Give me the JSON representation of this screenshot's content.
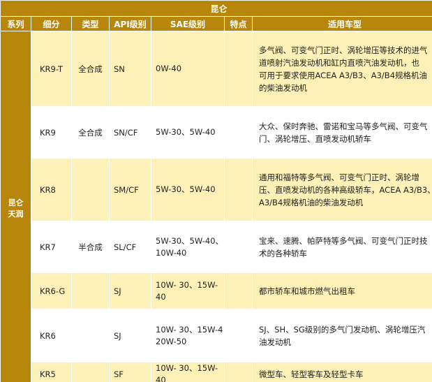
{
  "title": "昆仑",
  "headers": [
    "系列",
    "细分",
    "类型",
    "API级别",
    "SAE级别",
    "特点",
    "适用车型"
  ],
  "series_label": [
    "昆仑",
    "天润"
  ],
  "rows": [
    {
      "code": "KR9-T",
      "type": "全合成",
      "api": "SN",
      "sae": "0W-40",
      "feature": "",
      "cars": [
        "多气阀、可变气门正时、涡轮增压等技术的进气",
        "道喷射汽油发动机和缸内直喷汽油发动机，也",
        "可用于要求使用ACEA A3/B3、A3/B4规格机油",
        "的柴油发动机"
      ]
    },
    {
      "code": "KR9",
      "type": "全合成",
      "api": "SN/CF",
      "sae": "5W-30、5W-40",
      "feature": "",
      "cars": [
        "大众、保时奔驰、雷诺和宝马等多气阀、可变气",
        "门、涡轮增压、直喷发动机轿车"
      ]
    },
    {
      "code": "KR8",
      "type": "",
      "api": "SM/CF",
      "sae": "5W-30、5W-40",
      "feature": "",
      "cars": [
        "通用和福特等多气阀、可变气门正时、涡轮增",
        "压、直喷发动机的各种高级轿车，ACEA A3/B3、",
        "A3/B4规格机油的柴油发动机"
      ]
    },
    {
      "code": "KR7",
      "type": "半合成",
      "api": "SL/CF",
      "sae": [
        "5W-30、5W-40、",
        "10W-40"
      ],
      "feature": "",
      "cars": [
        "宝来、速腾、帕萨特等多气阀、可变气门正时技",
        "术的各种轿车"
      ]
    },
    {
      "code": "KR6-G",
      "type": "",
      "api": "SJ",
      "sae": "10W- 30、15W-40",
      "feature": "",
      "cars": [
        "都市轿车和城市燃气出租车"
      ]
    },
    {
      "code": "KR6",
      "type": "",
      "api": "SJ",
      "sae": [
        "10W- 30、15W-4",
        "20W-50"
      ],
      "feature": "",
      "cars": [
        "SJ、SH、SG级别的多气门发动机、涡轮增压汽",
        "油发动机"
      ]
    },
    {
      "code": "KR5",
      "type": "",
      "api": "SF",
      "sae": "10W- 30、15W-40",
      "feature": "",
      "cars": [
        "微型车、轻型客车及轻型卡车"
      ]
    }
  ]
}
